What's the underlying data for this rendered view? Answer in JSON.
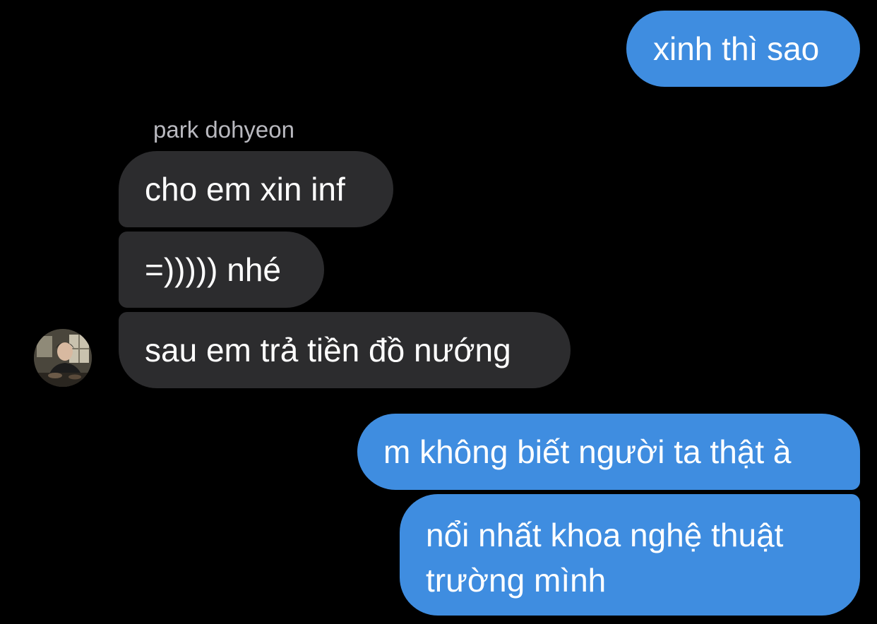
{
  "conversation": {
    "sender_name": "park dohyeon",
    "messages": [
      {
        "side": "outgoing",
        "text": "xinh thì sao"
      },
      {
        "side": "incoming",
        "text": "cho em xin inf"
      },
      {
        "side": "incoming",
        "text": "=))))) nhé"
      },
      {
        "side": "incoming",
        "text": "sau em trả tiền đồ nướng"
      },
      {
        "side": "outgoing",
        "text": "m không biết người ta thật à"
      },
      {
        "side": "outgoing",
        "text": "nổi nhất khoa nghệ thuật trường mình"
      }
    ]
  },
  "colors": {
    "background": "#000000",
    "outgoing_bubble": "#3f8de0",
    "incoming_bubble": "#2c2c2e",
    "sender_name": "#b9b9bf"
  },
  "icons": {
    "avatar": "profile-photo-avatar"
  }
}
